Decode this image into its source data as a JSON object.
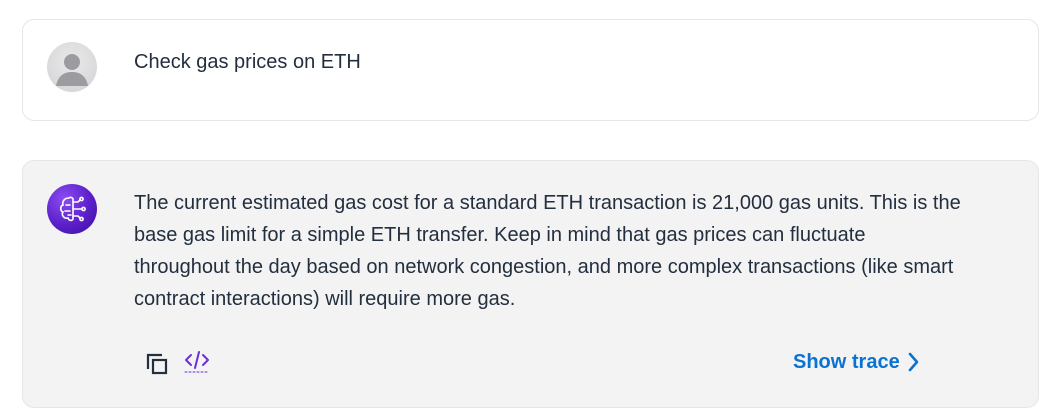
{
  "user_message": {
    "text": "Check gas prices on ETH",
    "avatar_icon": "user-avatar-icon"
  },
  "assistant_message": {
    "text": "The current estimated gas cost for a standard ETH transaction is 21,000 gas units. This is the base gas limit for a simple ETH transfer. Keep in mind that gas prices can fluctuate throughout the day based on network congestion, and more complex transactions (like smart contract interactions) will require more gas.",
    "avatar_icon": "ai-brain-icon",
    "actions": {
      "copy_icon": "copy-icon",
      "code_icon": "code-icon",
      "show_trace_label": "Show trace"
    }
  },
  "colors": {
    "accent_link": "#0972d3",
    "bot_avatar": "#5b1fc9",
    "code_icon": "#6b2fd6",
    "assistant_bg": "#f3f3f4"
  }
}
